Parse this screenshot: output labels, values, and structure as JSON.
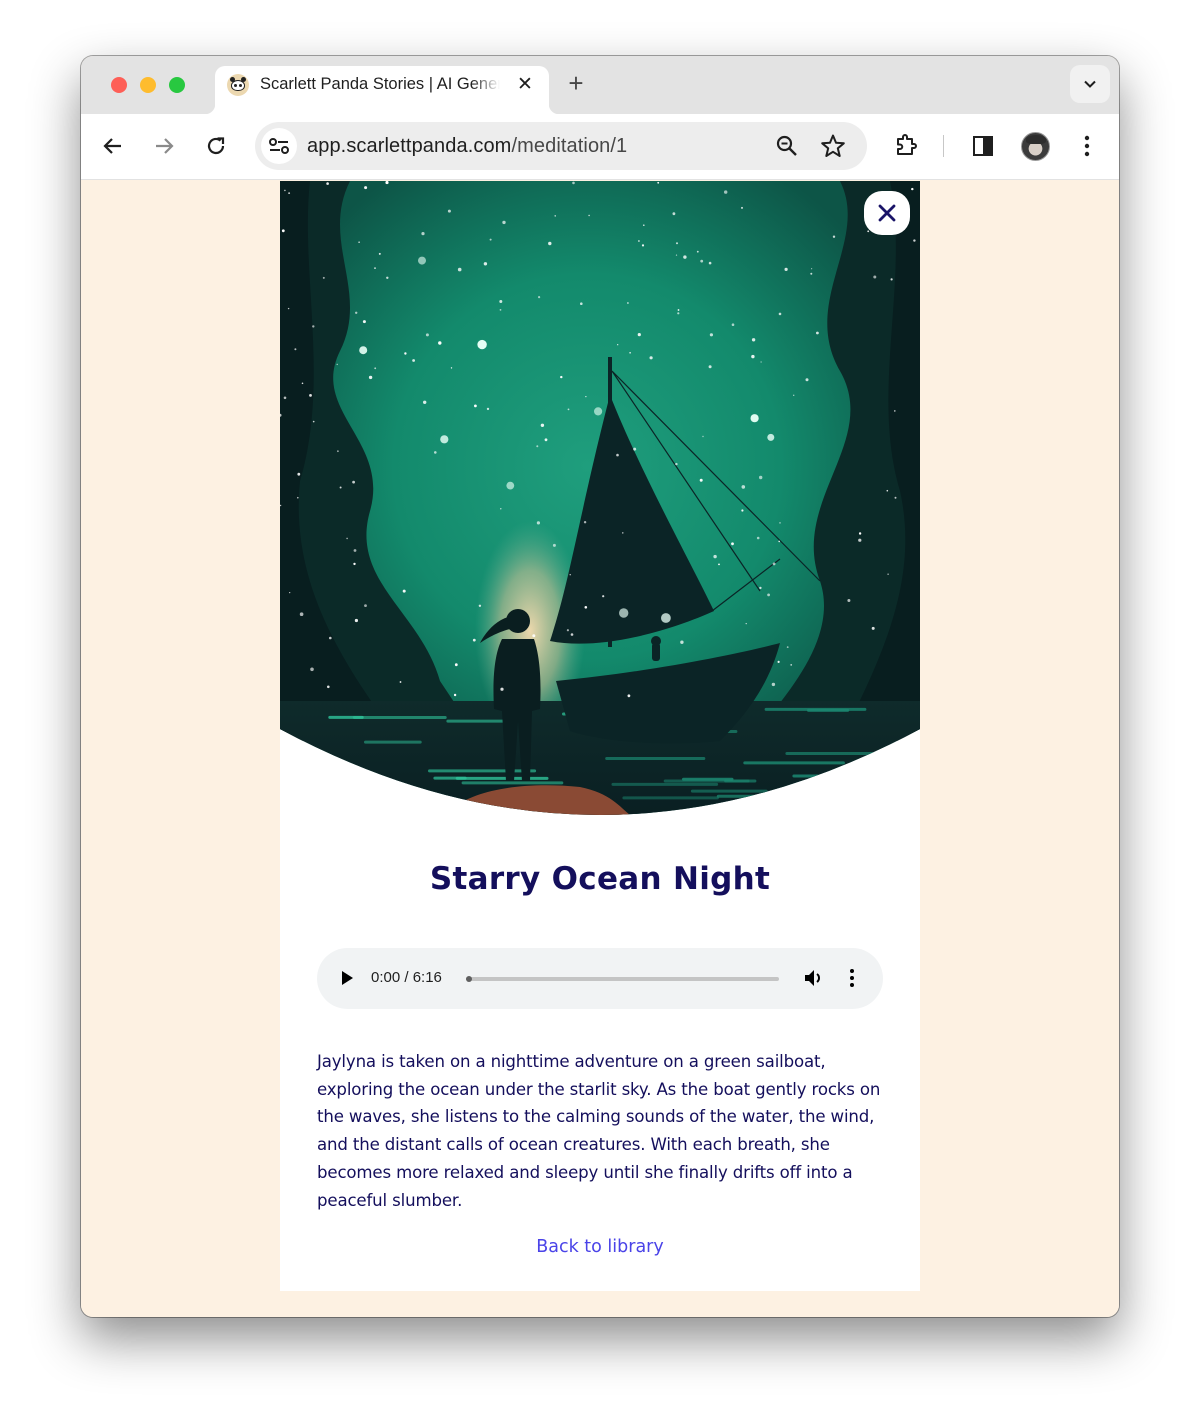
{
  "browser": {
    "tab": {
      "title": "Scarlett Panda Stories | AI Generated",
      "favicon": "panda-icon",
      "close_glyph": "✕"
    },
    "new_tab_glyph": "+",
    "tab_search_icon": "chevron-down-icon",
    "nav": {
      "back_icon": "arrow-left-icon",
      "forward_icon": "arrow-right-icon",
      "reload_icon": "reload-icon"
    },
    "address_bar": {
      "domain": "app.scarlettpanda.com",
      "path": "/meditation/1",
      "site_info_icon": "tune-icon",
      "zoom_icon": "zoom-out-icon",
      "bookmark_icon": "star-icon"
    },
    "toolbar_icons": [
      "extensions-icon",
      "side-panel-icon",
      "profile-avatar",
      "kebab-menu-icon"
    ]
  },
  "page": {
    "background_color": "#fdf1e2",
    "hero": {
      "alt": "Girl standing on a rocky shore looking at a sailboat under a starry green night sky",
      "close_glyph": "✕"
    },
    "title": "Starry Ocean Night",
    "title_color": "#140f5c",
    "player": {
      "current_time": "0:00",
      "duration": "6:16",
      "time_display": "0:00 / 6:16",
      "progress": 0,
      "play_icon": "play-icon",
      "volume_icon": "volume-icon",
      "more_icon": "more-vert-icon"
    },
    "description": "Jaylyna is taken on a nighttime adventure on a green sailboat, exploring the ocean under the starlit sky. As the boat gently rocks on the waves, she listens to the calming sounds of the water, the wind, and the distant calls of ocean creatures. With each breath, she becomes more relaxed and sleepy until she finally drifts off into a peaceful slumber.",
    "back_link": "Back to library",
    "link_color": "#4a43e8"
  }
}
